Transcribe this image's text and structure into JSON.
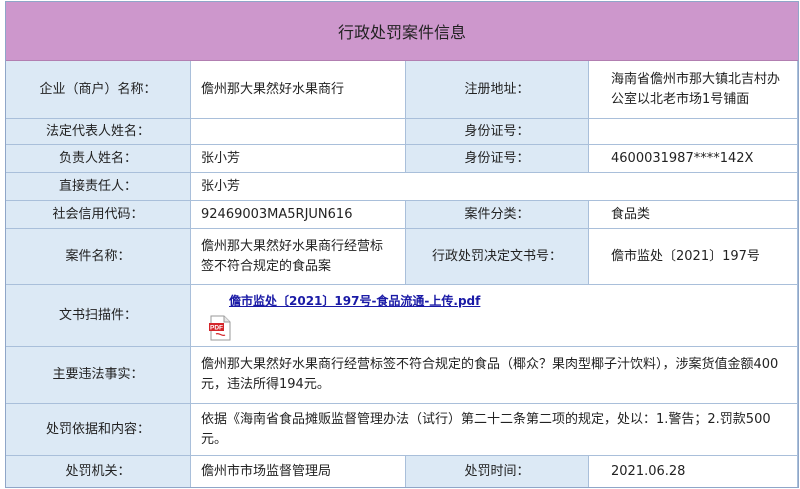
{
  "title": "行政处罚案件信息",
  "fields": {
    "enterprise_label": "企业（商户）名称：",
    "enterprise_value": "儋州那大果然好水果商行",
    "reg_address_label": "注册地址：",
    "reg_address_value": "海南省儋州市那大镇北吉村办公室以北老市场1号铺面",
    "legal_rep_label": "法定代表人姓名：",
    "legal_rep_value": "",
    "id_label_1": "身份证号：",
    "id_value_1": "",
    "principal_label": "负责人姓名：",
    "principal_value": "张小芳",
    "id_label_2": "身份证号：",
    "id_value_2": "4600031987****142X",
    "direct_resp_label": "直接责任人：",
    "direct_resp_value": "张小芳",
    "credit_code_label": "社会信用代码：",
    "credit_code_value": "92469003MA5RJUN616",
    "case_category_label": "案件分类：",
    "case_category_value": "食品类",
    "case_name_label": "案件名称：",
    "case_name_value": "儋州那大果然好水果商行经营标签不符合规定的食品案",
    "decision_no_label": "行政处罚决定文书号：",
    "decision_no_value": "儋市监处〔2021〕197号",
    "scan_label": "文书扫描件：",
    "scan_link": "儋市监处〔2021〕197号-食品流通-上传.pdf",
    "facts_label": "主要违法事实：",
    "facts_value": "儋州那大果然好水果商行经营标签不符合规定的食品（椰众？果肉型椰子汁饮料），涉案货值金额400元，违法所得194元。",
    "basis_label": "处罚依据和内容：",
    "basis_value": "依据《海南省食品摊贩监督管理办法（试行）第二十二条第二项的规定，处以：1.警告；2.罚款500元。",
    "authority_label": "处罚机关：",
    "authority_value": "儋州市市场监督管理局",
    "date_label": "处罚时间：",
    "date_value": "2021.06.28"
  },
  "icons": {
    "file_icon": "pdf-icon"
  },
  "colors": {
    "title_bg": "#cd97cc",
    "label_bg": "#dce9f5",
    "value_bg": "#ffffff",
    "link": "#1a1aa6"
  }
}
